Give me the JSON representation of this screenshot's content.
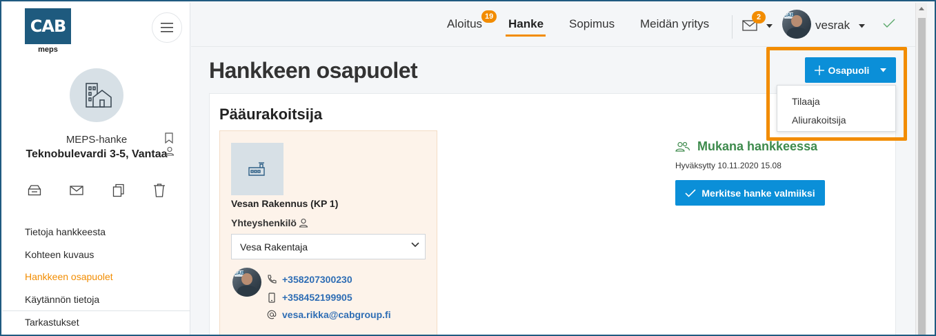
{
  "sidebar": {
    "logo_text": "CAB",
    "logo_sub": "meps",
    "project_name": "MEPS-hanke",
    "project_address": "Teknobulevardi 3-5, Vantaa",
    "nav": [
      {
        "label": "Tietoja hankkeesta"
      },
      {
        "label": "Kohteen kuvaus"
      },
      {
        "label": "Hankkeen osapuolet",
        "active": true
      },
      {
        "label": "Käytännön tietoja"
      },
      {
        "label": "Tarkastukset"
      }
    ]
  },
  "topbar": {
    "nav": [
      {
        "label": "Aloitus",
        "badge": "19"
      },
      {
        "label": "Hanke",
        "active": true
      },
      {
        "label": "Sopimus"
      },
      {
        "label": "Meidän yritys"
      }
    ],
    "mail_badge": "2",
    "username": "vesrak",
    "avatar_sign": "CAB"
  },
  "main": {
    "page_title": "Hankkeen osapuolet",
    "add_button": "Osapuoli",
    "dropdown_items": [
      "Tilaaja",
      "Aliurakoitsija"
    ],
    "section_title": "Pääurakoitsija",
    "contractor": {
      "company": "Vesan Rakennus (KP 1)",
      "contact_label": "Yhteyshenkilö",
      "selected_contact": "Vesa Rakentaja",
      "phone": "+358207300230",
      "mobile": "+358452199905",
      "email": "vesa.rikka@cabgroup.fi"
    },
    "status": {
      "heading": "Mukana hankkeessa",
      "approved": "Hyväksytty 10.11.2020 15.08",
      "button": "Merkitse hanke valmiiksi"
    }
  },
  "colors": {
    "accent": "#f28c00",
    "primary": "#0b8fd8",
    "brand": "#1e5a7e",
    "success": "#3d8a4c"
  }
}
